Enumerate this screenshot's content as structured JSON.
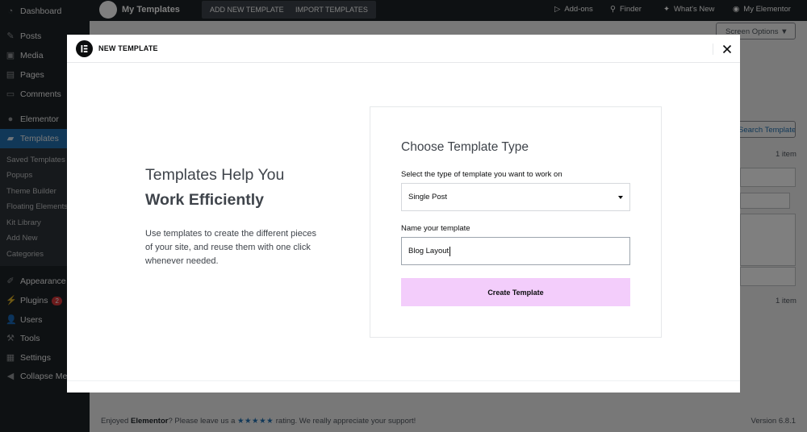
{
  "sidebar": {
    "items": [
      {
        "label": "Dashboard",
        "icon": "dashboard-icon"
      },
      {
        "label": "Posts",
        "icon": "pin-icon"
      },
      {
        "label": "Media",
        "icon": "media-icon"
      },
      {
        "label": "Pages",
        "icon": "pages-icon"
      },
      {
        "label": "Comments",
        "icon": "comment-icon"
      },
      {
        "label": "Elementor",
        "icon": "elementor-icon"
      },
      {
        "label": "Templates",
        "icon": "folder-icon"
      },
      {
        "label": "Appearance",
        "icon": "brush-icon"
      },
      {
        "label": "Plugins",
        "icon": "plug-icon",
        "badge": "2"
      },
      {
        "label": "Users",
        "icon": "user-icon"
      },
      {
        "label": "Tools",
        "icon": "wrench-icon"
      },
      {
        "label": "Settings",
        "icon": "settings-icon"
      },
      {
        "label": "Collapse Menu",
        "icon": "collapse-icon"
      }
    ],
    "submenu": [
      "Saved Templates",
      "Popups",
      "Theme Builder",
      "Floating Elements",
      "Kit Library",
      "Add New",
      "Categories"
    ]
  },
  "topbar": {
    "title": "My Templates",
    "add_new": "ADD NEW TEMPLATE",
    "import": "IMPORT TEMPLATES",
    "addons": "Add-ons",
    "finder": "Finder",
    "whats_new": "What's New",
    "my_elementor": "My Elementor"
  },
  "background": {
    "screen_options": "Screen Options ▼",
    "search_templates": "Search Template",
    "count_top": "1 item",
    "count_bottom": "1 item",
    "footer_prefix": "Enjoyed ",
    "footer_brand": "Elementor",
    "footer_mid": "? Please leave us a ",
    "footer_stars": "★★★★★",
    "footer_suffix": " rating. We really appreciate your support!",
    "version": "Version 6.8.1"
  },
  "modal": {
    "title": "NEW TEMPLATE",
    "intro_heading_line1": "Templates Help You",
    "intro_heading_line2": "Work Efficiently",
    "intro_description": "Use templates to create the different pieces of your site, and reuse them with one click whenever needed.",
    "form_title": "Choose Template Type",
    "type_label": "Select the type of template you want to work on",
    "type_value": "Single Post",
    "name_label": "Name your template",
    "name_value": "Blog Layout",
    "create_button": "Create Template"
  },
  "colors": {
    "sidebar": "#1d2327",
    "active": "#2271b1",
    "create_button_bg": "#f3cdfb",
    "modal_text": "#3f444b"
  }
}
